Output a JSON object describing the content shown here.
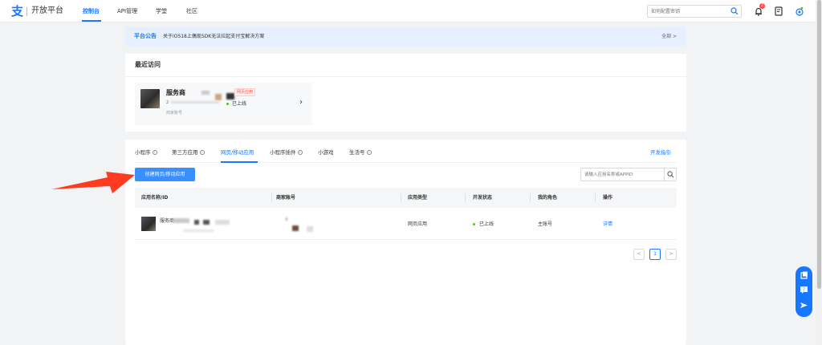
{
  "header": {
    "logo_text": "开放平台",
    "nav": [
      "控制台",
      "API管理",
      "学堂",
      "社区"
    ],
    "search_placeholder": "如何配置密钥",
    "notification_count": "2"
  },
  "announcement": {
    "tag": "平台公告",
    "message": "关于iOS18上偶现SDK无法拉起支付宝解决方案",
    "all_link": "全部 >"
  },
  "recent": {
    "title": "最近访问",
    "item": {
      "name": "服务商",
      "id_prefix": "2",
      "account_label": "商家账号",
      "tag": "网页应用",
      "status": "已上线"
    }
  },
  "apps": {
    "tabs": [
      "小程序",
      "第三方应用",
      "网页/移动应用",
      "小程序插件",
      "小游戏",
      "生活号"
    ],
    "dev_guide": "开发指引",
    "create_button": "创建网页/移动应用",
    "search_placeholder": "请输入应用名称或APPID",
    "columns": [
      "应用名称/ID",
      "商家账号",
      "应用类型",
      "开发状态",
      "我的角色",
      "操作"
    ],
    "rows": [
      {
        "name": "服务商",
        "type": "网页应用",
        "status": "已上线",
        "role": "主账号",
        "action": "详情"
      }
    ],
    "pager": {
      "prev": "<",
      "current": "1",
      "next": ">"
    }
  },
  "colors": {
    "primary": "#1677ff",
    "annotation_arrow": "#ff3b1f",
    "status_online": "#52c41a"
  }
}
